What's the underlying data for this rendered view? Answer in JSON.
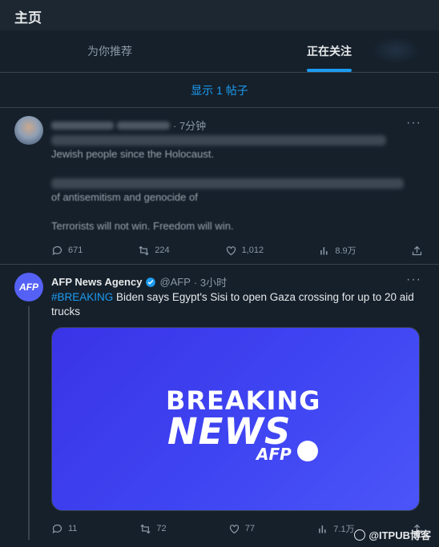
{
  "topbar": {
    "title": "主页"
  },
  "tabs": [
    {
      "label": "为你推荐",
      "active": false
    },
    {
      "label": "正在关注",
      "active": true
    }
  ],
  "show_more": "显示 1 帖子",
  "tweet1": {
    "time": "· 7分钟",
    "text_fragments": [
      "Jewish people since the Holocaust.",
      "of antisemitism and genocide of",
      "Terrorists will not win. Freedom will win."
    ],
    "actions": {
      "reply": "671",
      "retweet": "224",
      "like": "1,012",
      "views": "8.9万"
    }
  },
  "tweet2": {
    "avatar_label": "AFP",
    "name": "AFP News Agency",
    "handle": "@AFP",
    "time": "· 3小时",
    "hashtag": "#BREAKING",
    "text": " Biden says Egypt's Sisi to open Gaza crossing for up to 20 aid trucks",
    "media": {
      "line1": "BREAKING",
      "line2": "NEWS",
      "logo": "AFP"
    },
    "actions": {
      "reply": "11",
      "retweet": "72",
      "like": "77",
      "views": "7.1万"
    }
  },
  "watermark": "@ITPUB博客",
  "colors": {
    "accent": "#1d9bf0",
    "background": "#15202b",
    "media": "#3a34e6"
  }
}
